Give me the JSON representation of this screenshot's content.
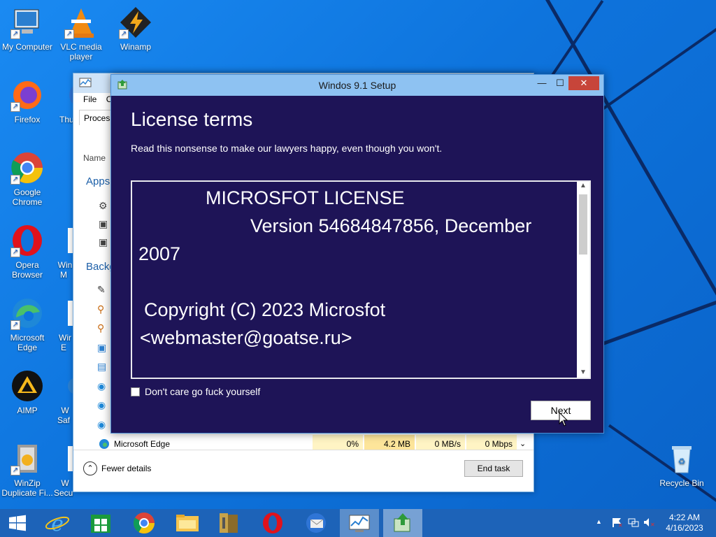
{
  "desktop": {
    "icons": [
      {
        "label": "My Computer",
        "icon": "computer-icon"
      },
      {
        "label": "VLC media player",
        "icon": "vlc-icon"
      },
      {
        "label": "Winamp",
        "icon": "winamp-icon"
      },
      {
        "label": "Firefox",
        "icon": "firefox-icon"
      },
      {
        "label": "Thu",
        "icon": "thunderbird-icon"
      },
      {
        "label": "Google Chrome",
        "icon": "chrome-icon"
      },
      {
        "label": "Opera Browser",
        "icon": "opera-icon"
      },
      {
        "label": "Win M",
        "icon": "app-icon"
      },
      {
        "label": "Microsoft Edge",
        "icon": "edge-icon"
      },
      {
        "label": "Wir E",
        "icon": "app-icon"
      },
      {
        "label": "AIMP",
        "icon": "aimp-icon"
      },
      {
        "label": "W Saf",
        "icon": "app-icon"
      },
      {
        "label": "WinZip Duplicate Fi...",
        "icon": "winzip-icon"
      },
      {
        "label": "W Secur...",
        "icon": "app-icon"
      },
      {
        "label": "Recycle Bin",
        "icon": "recycle-bin-icon"
      }
    ]
  },
  "taskmgr": {
    "menu_file": "File",
    "menu_c": "C",
    "tab": "Process",
    "col_name": "Name",
    "section_apps": "Apps",
    "section_background": "Backg",
    "row": {
      "name": "Microsoft Edge",
      "cpu": "0%",
      "memory": "4.2 MB",
      "disk": "0 MB/s",
      "network": "0 Mbps"
    },
    "fewer_details": "Fewer details",
    "end_task": "End task"
  },
  "setup": {
    "title": "Windos 9.1 Setup",
    "minimize": "—",
    "maximize": "☐",
    "close": "✕",
    "heading": "License terms",
    "subtext": "Read this nonsense to make our lawyers happy, even though you won't.",
    "license_lines": [
      "MICROSFOT LICENSE",
      "Version 54684847856, December",
      "2007",
      "Copyright (C) 2023 Microsfot",
      "<webmaster@goatse.ru>"
    ],
    "checkbox_label": "Don't care go fuck yourself",
    "checkbox_checked": false,
    "next": "Next"
  },
  "taskbar": {
    "time": "4:22 AM",
    "date": "4/16/2023",
    "apps": [
      "windows-start-icon",
      "ie-icon",
      "store-icon",
      "chrome-icon",
      "file-explorer-icon",
      "archive-icon",
      "opera-icon",
      "thunderbird-icon",
      "taskmgr-icon",
      "setup-icon"
    ]
  },
  "colors": {
    "setup_bg": "#1e1457",
    "accent": "#1d63b8",
    "close": "#c7453a"
  }
}
